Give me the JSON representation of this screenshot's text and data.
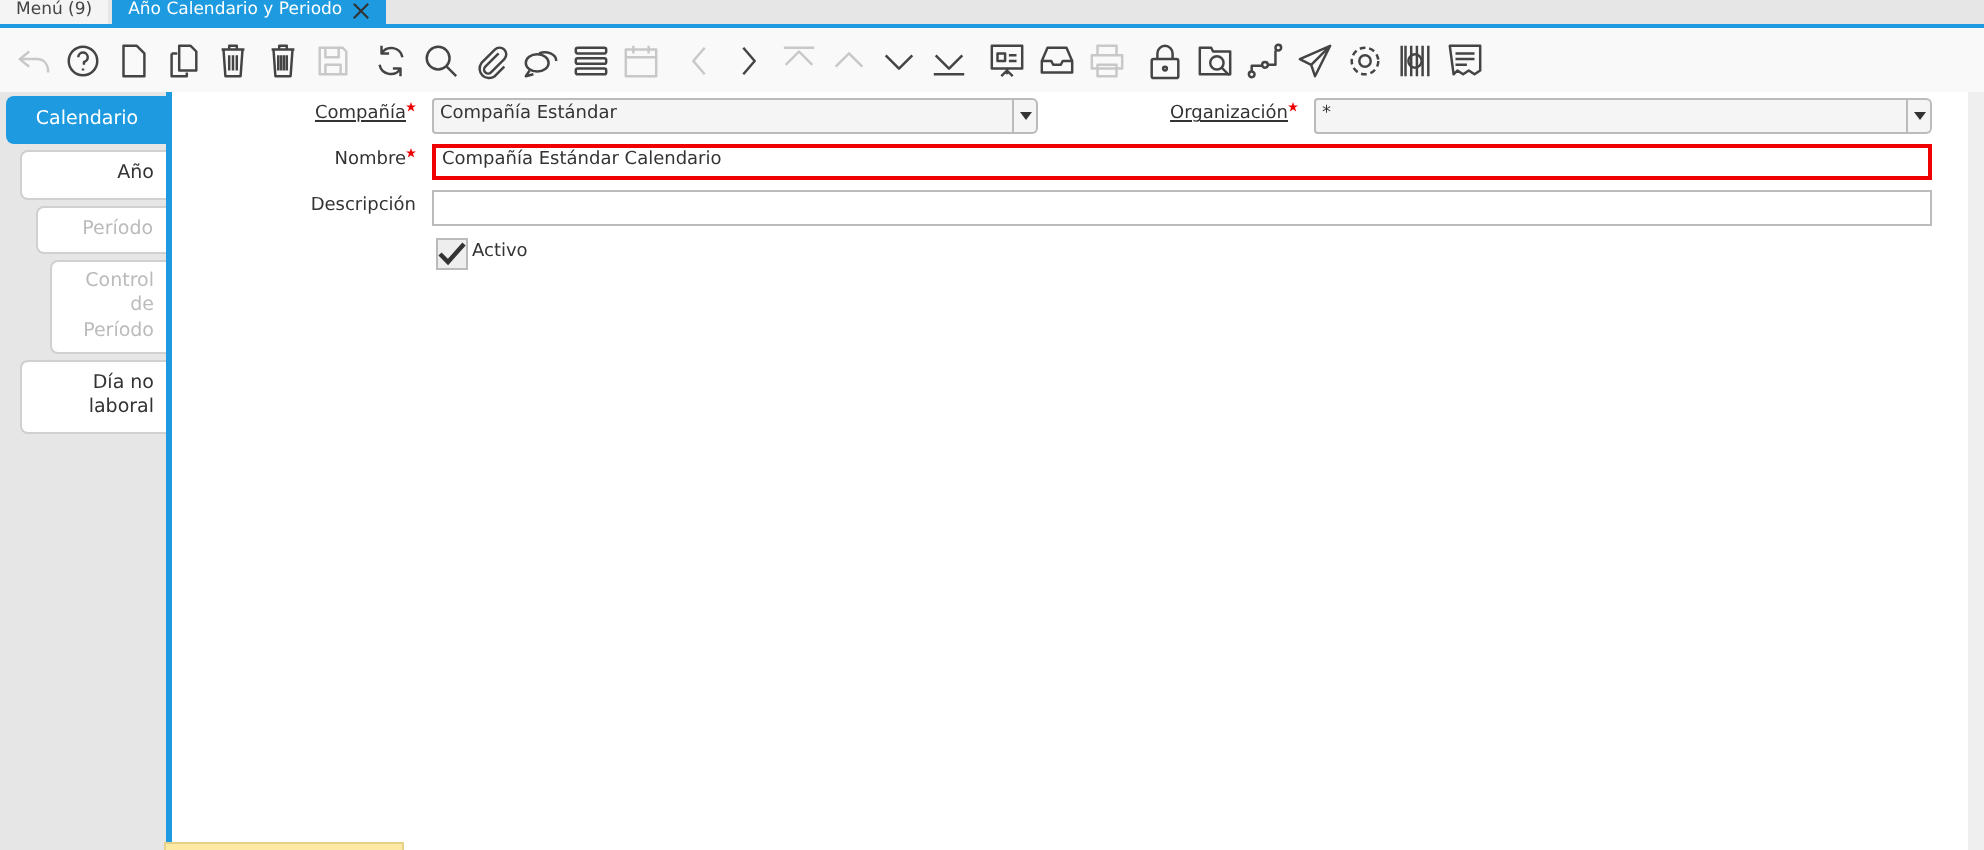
{
  "tabs": [
    {
      "label": "Menú (9)",
      "selected": false,
      "closable": false
    },
    {
      "label": "Año Calendario y Periodo",
      "selected": true,
      "closable": true
    }
  ],
  "toolbar": [
    {
      "kind": "undo",
      "disabled": true
    },
    {
      "kind": "help",
      "disabled": false
    },
    {
      "kind": "new",
      "disabled": false
    },
    {
      "kind": "copy",
      "disabled": false
    },
    {
      "kind": "delete",
      "disabled": false
    },
    {
      "kind": "delete-multi",
      "disabled": false
    },
    {
      "kind": "save",
      "disabled": true
    },
    {
      "kind": "refresh",
      "disabled": false
    },
    {
      "kind": "search",
      "disabled": false
    },
    {
      "kind": "attach",
      "disabled": false
    },
    {
      "kind": "chat",
      "disabled": false
    },
    {
      "kind": "grid",
      "disabled": false
    },
    {
      "kind": "calendar",
      "disabled": true
    },
    {
      "kind": "prev",
      "disabled": true
    },
    {
      "kind": "next",
      "disabled": false
    },
    {
      "kind": "first",
      "disabled": true
    },
    {
      "kind": "up",
      "disabled": true
    },
    {
      "kind": "down",
      "disabled": false
    },
    {
      "kind": "last",
      "disabled": false
    },
    {
      "kind": "report",
      "disabled": false
    },
    {
      "kind": "archive",
      "disabled": false
    },
    {
      "kind": "print",
      "disabled": true
    },
    {
      "kind": "lock",
      "disabled": false
    },
    {
      "kind": "zoom",
      "disabled": false
    },
    {
      "kind": "workflow",
      "disabled": false
    },
    {
      "kind": "send",
      "disabled": false
    },
    {
      "kind": "gear",
      "disabled": false
    },
    {
      "kind": "barcode",
      "disabled": false
    },
    {
      "kind": "receipt",
      "disabled": false
    }
  ],
  "side_tabs": [
    {
      "label": "Calendario",
      "selected": true,
      "disabled": false,
      "children": [
        {
          "label": "Año",
          "selected": false,
          "disabled": false,
          "children": [
            {
              "label": "Período",
              "selected": false,
              "disabled": true,
              "children": [
                {
                  "label": "Control de Período",
                  "selected": false,
                  "disabled": true
                }
              ]
            }
          ]
        },
        {
          "label": "Día no laboral",
          "selected": false,
          "disabled": false
        }
      ]
    }
  ],
  "form": {
    "fields": [
      {
        "kind": "select",
        "label": "Compañía",
        "required": true,
        "underlined": true,
        "invalid": false,
        "value": "Compañía Estándar"
      },
      {
        "kind": "select",
        "label": "Organización",
        "required": true,
        "underlined": true,
        "invalid": false,
        "value": "*"
      },
      {
        "kind": "text",
        "label": "Nombre",
        "required": true,
        "underlined": false,
        "invalid": true,
        "value": "Compañía Estándar Calendario"
      },
      {
        "kind": "text",
        "label": "Descripción",
        "required": false,
        "underlined": false,
        "invalid": false
      }
    ],
    "checkbox": {
      "label": "Activo",
      "checked": true
    }
  }
}
